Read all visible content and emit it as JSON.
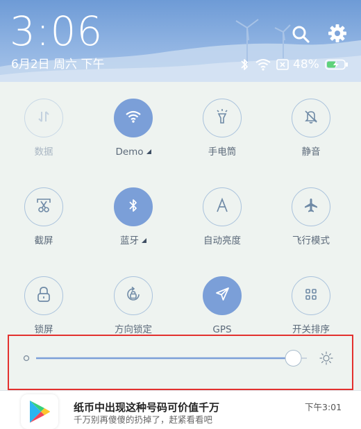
{
  "header": {
    "time": "3:06",
    "date": "6月2日 周六 下午",
    "battery_percent": "48%",
    "icons": [
      "search-icon",
      "gear-icon",
      "bluetooth-icon",
      "wifi-icon",
      "no-sim-icon",
      "battery-charging-icon"
    ]
  },
  "tiles": [
    {
      "label": "数据",
      "icon": "data-arrows-icon",
      "state": "disabled"
    },
    {
      "label": "Demo",
      "icon": "wifi-icon",
      "state": "on",
      "has_more": true
    },
    {
      "label": "手电筒",
      "icon": "flashlight-icon",
      "state": "off"
    },
    {
      "label": "静音",
      "icon": "bell-mute-icon",
      "state": "off"
    },
    {
      "label": "截屏",
      "icon": "scissors-icon",
      "state": "off"
    },
    {
      "label": "蓝牙",
      "icon": "bluetooth-icon",
      "state": "on",
      "has_more": true
    },
    {
      "label": "自动亮度",
      "icon": "auto-brightness-icon",
      "state": "off"
    },
    {
      "label": "飞行模式",
      "icon": "airplane-icon",
      "state": "off"
    },
    {
      "label": "锁屏",
      "icon": "lock-icon",
      "state": "off"
    },
    {
      "label": "方向锁定",
      "icon": "rotation-lock-icon",
      "state": "off"
    },
    {
      "label": "GPS",
      "icon": "location-arrow-icon",
      "state": "on"
    },
    {
      "label": "开关排序",
      "icon": "grid-icon",
      "state": "off"
    }
  ],
  "brightness": {
    "level": 0.95,
    "icons": [
      "brightness-low-icon",
      "brightness-high-icon"
    ]
  },
  "notification": {
    "title": "纸币中出现这种号码可价值千万",
    "subtitle": "千万别再傻傻的扔掉了，赶紧看看吧",
    "time": "下午3:01",
    "app_icon": "play-store-icon"
  },
  "colors": {
    "accent": "#7b9fd8",
    "highlight": "#e3302e",
    "header_top": "#6e9bd6"
  }
}
